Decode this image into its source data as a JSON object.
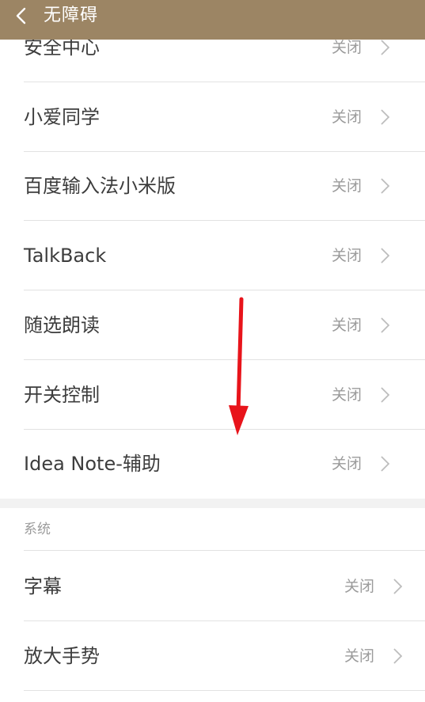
{
  "header": {
    "title": "无障碍",
    "bg_color": "#9c8564"
  },
  "services": [
    {
      "title": "安全中心",
      "value": "关闭"
    },
    {
      "title": "小爱同学",
      "value": "关闭"
    },
    {
      "title": "百度输入法小米版",
      "value": "关闭"
    },
    {
      "title": "TalkBack",
      "value": "关闭"
    },
    {
      "title": "随选朗读",
      "value": "关闭"
    },
    {
      "title": "开关控制",
      "value": "关闭"
    },
    {
      "title": "Idea Note-辅助",
      "value": "关闭"
    }
  ],
  "system_section": {
    "label": "系统",
    "items": [
      {
        "title": "字幕",
        "value": "关闭"
      },
      {
        "title": "放大手势",
        "value": "关闭"
      }
    ]
  },
  "annotation": {
    "type": "red-arrow",
    "direction": "down",
    "color": "#e8141b"
  }
}
